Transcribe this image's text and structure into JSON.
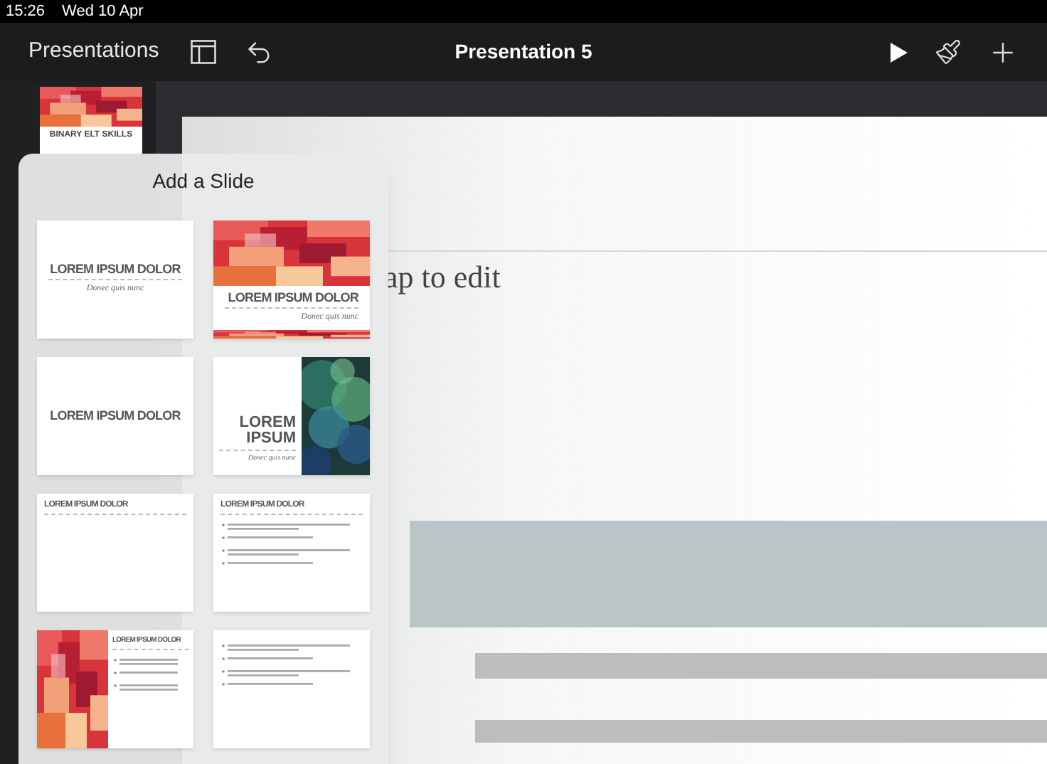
{
  "status_bar": {
    "time": "15:26",
    "date": "Wed 10 Apr"
  },
  "toolbar": {
    "back": "Presentations",
    "title": "Presentation 5"
  },
  "navigator": {
    "slides": [
      {
        "title": "BINARY ELT SKILLS"
      }
    ]
  },
  "slide": {
    "placeholder": "ap to edit"
  },
  "popover": {
    "title": "Add a Slide",
    "layouts": [
      {
        "kind": "title",
        "title": "LOREM IPSUM DOLOR",
        "subtitle": "Donec quis nunc"
      },
      {
        "kind": "photo-top",
        "title": "LOREM IPSUM DOLOR",
        "subtitle": "Donec quis nunc"
      },
      {
        "kind": "title-only",
        "title": "LOREM IPSUM DOLOR"
      },
      {
        "kind": "photo-right",
        "title": "LOREM IPSUM",
        "subtitle": "Donec quis nunc"
      },
      {
        "kind": "title-top",
        "title": "LOREM IPSUM DOLOR"
      },
      {
        "kind": "title-bullets",
        "title": "LOREM IPSUM DOLOR"
      },
      {
        "kind": "photo-bullets",
        "title": "LOREM IPSUM DOLOR"
      },
      {
        "kind": "bullets"
      }
    ]
  }
}
